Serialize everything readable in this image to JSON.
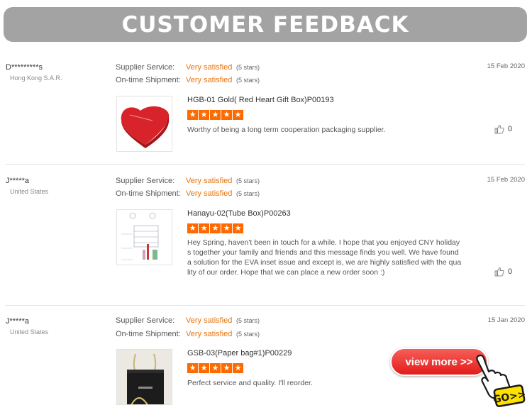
{
  "header": {
    "title": "CUSTOMER FEEDBACK"
  },
  "labels": {
    "supplier_service": "Supplier Service:",
    "ontime_shipment": "On-time Shipment:"
  },
  "reviews": [
    {
      "buyer": "D*********s",
      "country": "Hong Kong S.A.R.",
      "date": "15 Feb 2020",
      "supplier_rating": "Very satisfied",
      "supplier_stars": "(5 stars)",
      "shipment_rating": "Very satisfied",
      "shipment_stars": "(5 stars)",
      "product": "HGB-01 Gold( Red Heart Gift Box)P00193",
      "stars": 5,
      "comment": "Worthy of being a long term cooperation packaging supplier.",
      "likes": "0"
    },
    {
      "buyer": "J*****a",
      "country": "United States",
      "date": "15 Feb 2020",
      "supplier_rating": "Very satisfied",
      "supplier_stars": "(5 stars)",
      "shipment_rating": "Very satisfied",
      "shipment_stars": "(5 stars)",
      "product": "Hanayu-02(Tube Box)P00263",
      "stars": 5,
      "comment": "Hey Spring, haven't been in touch for a while. I hope that you enjoyed CNY holidays together your family and friends and this message finds you well. We have found a solution for the EVA inset issue and except is, we are highly satisfied with the quality of our order. Hope that we can place a new order soon :)",
      "likes": "0"
    },
    {
      "buyer": "J*****a",
      "country": "United States",
      "date": "15 Jan 2020",
      "supplier_rating": "Very satisfied",
      "supplier_stars": "(5 stars)",
      "shipment_rating": "Very satisfied",
      "shipment_stars": "(5 stars)",
      "product": "GSB-03(Paper bag#1)P00229",
      "stars": 5,
      "comment": "Perfect service and quality. I'll reorder.",
      "likes": ""
    }
  ],
  "cta": {
    "view_more": "view more >>",
    "go_label": "GO>>"
  },
  "colors": {
    "banner": "#a3a3a3",
    "accent": "#e8730a",
    "star": "#ff6a00",
    "button": "#e21c1a"
  },
  "icons": {
    "like": "thumbs-up-icon",
    "star": "star-icon",
    "pointer": "pointing-hand-icon"
  }
}
